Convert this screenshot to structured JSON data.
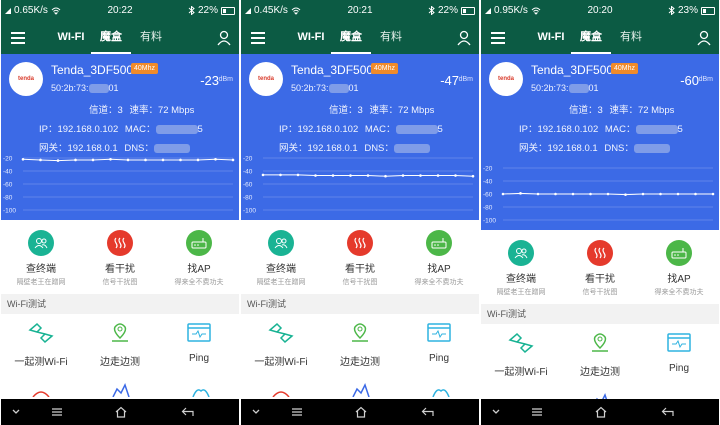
{
  "tabs": [
    "WI-FI",
    "魔盒",
    "有料"
  ],
  "card": {
    "ssid": "Tenda_3DF500",
    "bandwidth": "40Mhz",
    "rssi_unit": "dBm",
    "channel_label": "信道：3",
    "rate_label": "速率：72 Mbps",
    "ip_label": "IP：192.168.0.102",
    "mac_label": "MAC：",
    "gateway_label": "网关：192.168.0.1",
    "dns_label": "DNS：",
    "y_ticks": [
      "-20",
      "-40",
      "-60",
      "-80",
      "-100"
    ]
  },
  "tools": [
    {
      "label": "查终端",
      "sub": "隔壁老王在蹭网",
      "icon": "people-icon",
      "color": "#1ab394"
    },
    {
      "label": "看干扰",
      "sub": "信号干扰图",
      "icon": "heat-waves-icon",
      "color": "#e53a2c"
    },
    {
      "label": "找AP",
      "sub": "得来全不费功夫",
      "icon": "router-icon",
      "color": "#4cb748"
    }
  ],
  "section_title": "Wi-Fi测试",
  "grid": [
    {
      "label": "一起测Wi-Fi",
      "icon": "handshake-icon"
    },
    {
      "label": "边走边测",
      "icon": "location-pin-icon"
    },
    {
      "label": "Ping",
      "icon": "ping-window-icon"
    }
  ],
  "logo_text": "tenda",
  "phones": [
    {
      "status_speed": "0.65K/s",
      "time": "20:22",
      "battery": "22%",
      "rssi": "-23",
      "bssid": "50:2b:73:",
      "bssid_tail": "01",
      "mac_tail": "5",
      "chart_data": {
        "type": "line",
        "ylim": [
          -100,
          -20
        ],
        "series": [
          {
            "values": [
              -22,
              -23,
              -24,
              -23,
              -23,
              -22,
              -23,
              -23,
              -23,
              -23,
              -23,
              -22,
              -23
            ]
          }
        ]
      }
    },
    {
      "status_speed": "0.45K/s",
      "time": "20:21",
      "battery": "22%",
      "rssi": "-47",
      "bssid": "50:2b:73:",
      "bssid_tail": "01",
      "mac_tail": "5",
      "chart_data": {
        "type": "line",
        "ylim": [
          -100,
          -20
        ],
        "series": [
          {
            "values": [
              -46,
              -46,
              -46,
              -47,
              -47,
              -47,
              -47,
              -48,
              -47,
              -47,
              -47,
              -47,
              -48
            ]
          }
        ]
      }
    },
    {
      "status_speed": "0.95K/s",
      "time": "20:20",
      "battery": "23%",
      "rssi": "-60",
      "bssid": "50:2b:73:",
      "bssid_tail": "01",
      "mac_tail": "5",
      "chart_data": {
        "type": "line",
        "ylim": [
          -100,
          -20
        ],
        "series": [
          {
            "values": [
              -60,
              -59,
              -60,
              -60,
              -60,
              -60,
              -60,
              -61,
              -60,
              -60,
              -60,
              -60,
              -60
            ]
          }
        ]
      }
    }
  ]
}
